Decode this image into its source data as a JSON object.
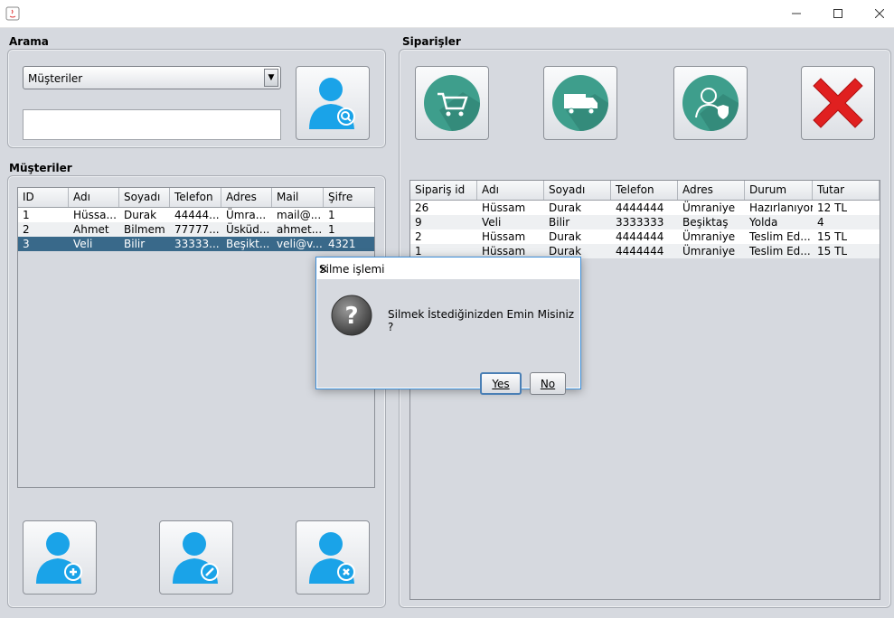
{
  "window": {
    "title": ""
  },
  "search": {
    "section_title": "Arama",
    "combo_value": "Müşteriler"
  },
  "customers": {
    "section_title": "Müşteriler",
    "columns": [
      "ID",
      "Adı",
      "Soyadı",
      "Telefon",
      "Adres",
      "Mail",
      "Şifre"
    ],
    "rows": [
      [
        "1",
        "Hüssa...",
        "Durak",
        "44444...",
        "Ümra...",
        "mail@...",
        "1"
      ],
      [
        "2",
        "Ahmet",
        "Bilmem",
        "77777...",
        "Üsküd...",
        "ahmet...",
        "1"
      ],
      [
        "3",
        "Veli",
        "Bilir",
        "33333...",
        "Beşikt...",
        "veli@v...",
        "4321"
      ]
    ],
    "selected_row": 2
  },
  "orders": {
    "section_title": "Siparişler",
    "columns": [
      "Sipariş id",
      "Adı",
      "Soyadı",
      "Telefon",
      "Adres",
      "Durum",
      "Tutar"
    ],
    "rows": [
      [
        "26",
        "Hüssam",
        "Durak",
        "4444444",
        "Ümraniye",
        "Hazırlanıyor",
        "12 TL"
      ],
      [
        "9",
        "Veli",
        "Bilir",
        "3333333",
        "Beşiktaş",
        "Yolda",
        "4"
      ],
      [
        "2",
        "Hüssam",
        "Durak",
        "4444444",
        "Ümraniye",
        "Teslim Ed...",
        "15 TL"
      ],
      [
        "1",
        "Hüssam",
        "Durak",
        "4444444",
        "Ümraniye",
        "Teslim Ed...",
        "15 TL"
      ]
    ]
  },
  "dialog": {
    "title": "Silme işlemi",
    "message": "Silmek İstediğinizden Emin Misiniz ?",
    "yes_label": "Yes",
    "no_label": "No"
  },
  "colors": {
    "selection": "#39698a",
    "accent_teal": "#3e9e8c",
    "user_blue": "#1aa3e8",
    "delete_red": "#e02020"
  }
}
